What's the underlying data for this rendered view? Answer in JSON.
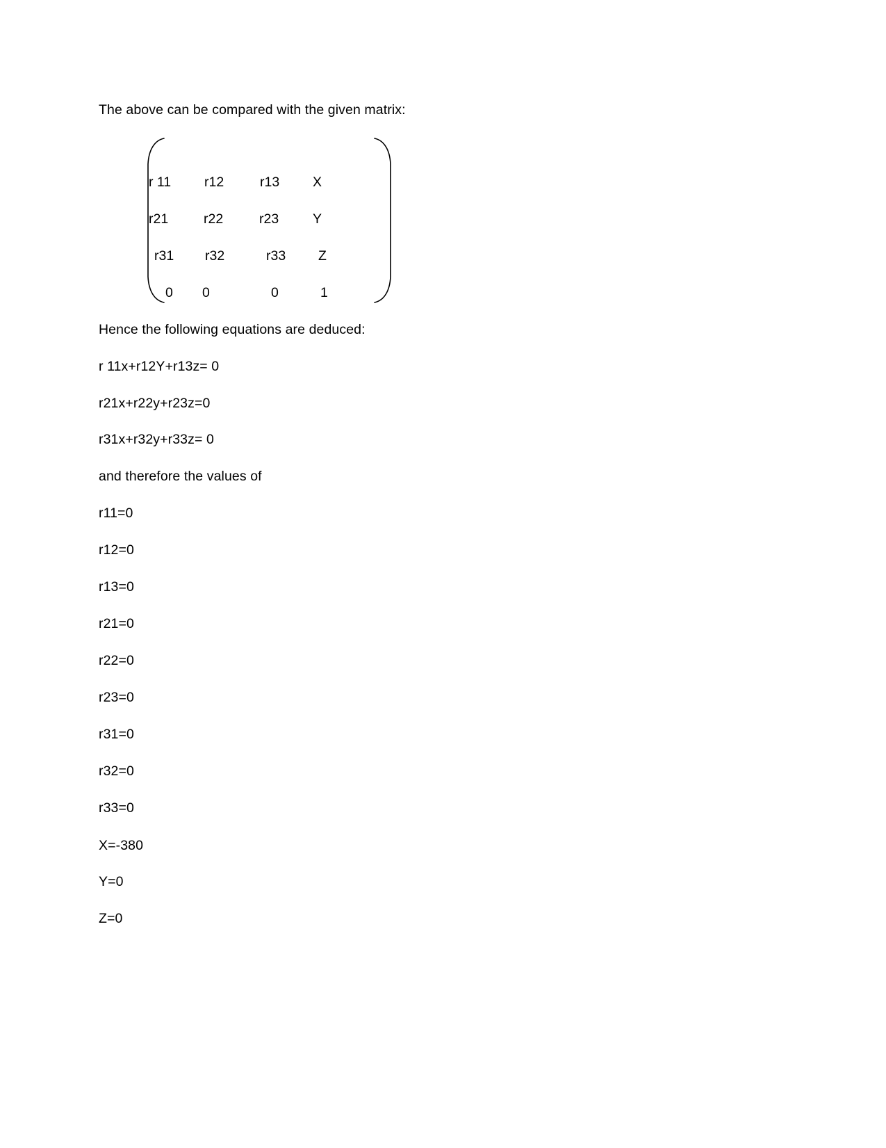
{
  "document": {
    "intro_line": "The above can be compared with the given matrix:",
    "deduced_line": "Hence the following equations are deduced:",
    "therefore_line": "and therefore the values of"
  },
  "matrix": {
    "rows": [
      [
        "r 11",
        "r12",
        "r13",
        "X"
      ],
      [
        "r21",
        "r22",
        "r23",
        "Y"
      ],
      [
        "r31",
        "r32",
        "r33",
        "Z"
      ],
      [
        "0",
        "0",
        "0",
        "1"
      ]
    ]
  },
  "equations": [
    "r 11x+r12Y+r13z= 0",
    "r21x+r22y+r23z=0",
    "r31x+r32y+r33z= 0"
  ],
  "values": [
    "r11=0",
    "r12=0",
    "r13=0",
    "r21=0",
    "r22=0",
    "r23=0",
    "r31=0",
    "r32=0",
    "r33=0",
    "X=-380",
    "Y=0",
    "Z=0"
  ],
  "colors": {
    "text": "#000000",
    "background": "#ffffff",
    "bracket": "#000000"
  }
}
